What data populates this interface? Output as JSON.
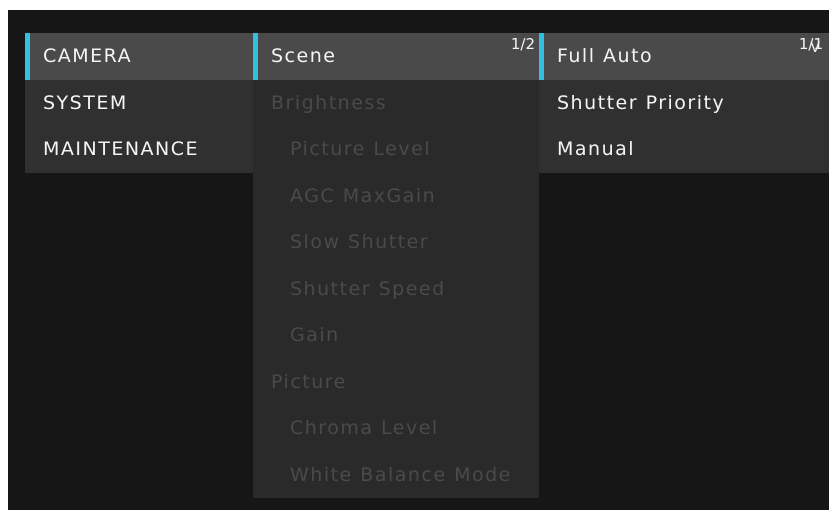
{
  "main_menu": {
    "items": [
      {
        "label": "CAMERA"
      },
      {
        "label": "SYSTEM"
      },
      {
        "label": "MAINTENANCE"
      }
    ]
  },
  "camera_menu": {
    "page_indicator": "1/2",
    "items": [
      {
        "label": "Scene"
      },
      {
        "label": "Brightness"
      },
      {
        "label": "Picture Level"
      },
      {
        "label": "AGC MaxGain"
      },
      {
        "label": "Slow Shutter"
      },
      {
        "label": "Shutter Speed"
      },
      {
        "label": "Gain"
      },
      {
        "label": "Picture"
      },
      {
        "label": "Chroma Level"
      },
      {
        "label": "White Balance Mode"
      }
    ]
  },
  "scene_menu": {
    "page_indicator": "1/1",
    "scroll_glyph": "V",
    "items": [
      {
        "label": "Full Auto"
      },
      {
        "label": "Shutter Priority"
      },
      {
        "label": "Manual"
      }
    ]
  },
  "colors": {
    "highlight": "#33bfe0",
    "background": "#161616",
    "disabled_text": "#4a4a4a"
  }
}
